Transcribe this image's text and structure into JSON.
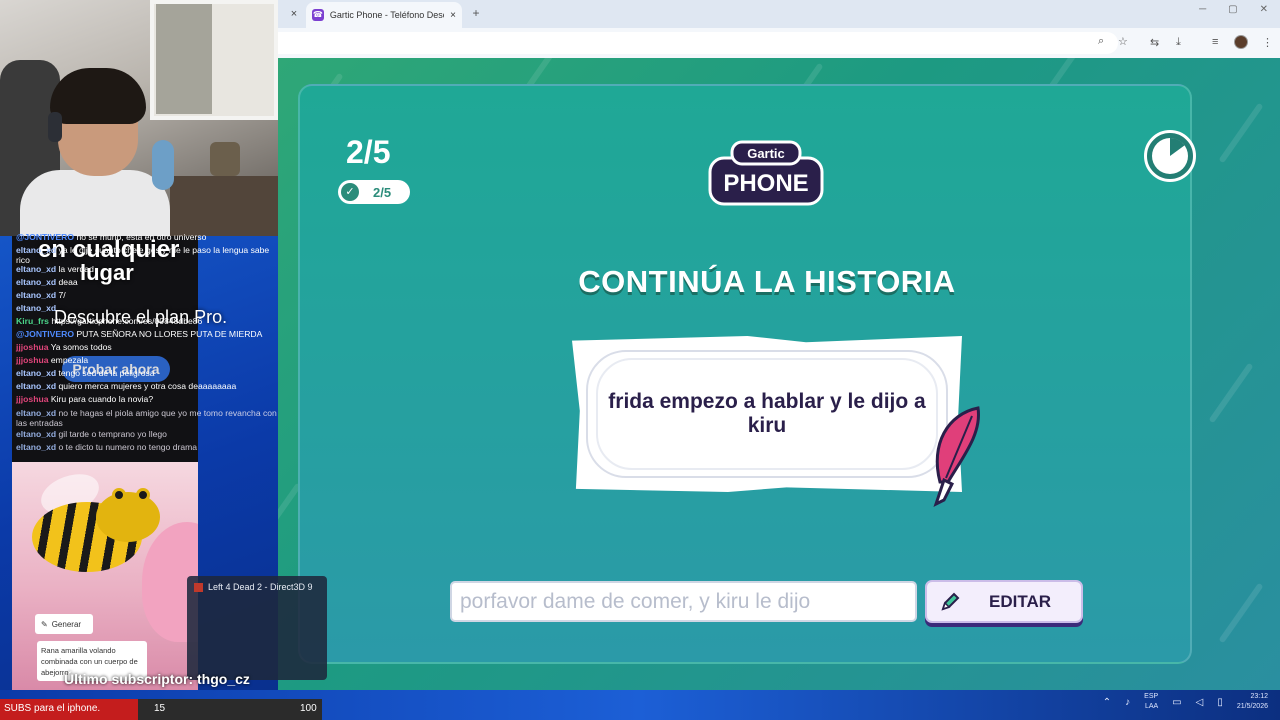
{
  "browser": {
    "tab_title": "Gartic Phone - Teléfono Descon",
    "new_tab": "+",
    "tab_close": "×",
    "prev_tab_close": "×"
  },
  "game": {
    "round_big": "2/5",
    "round_pill": "2/5",
    "logo_top": "Gartic",
    "logo_bottom": "PHONE",
    "heading": "CONTINÚA LA HISTORIA",
    "prompt": "frida empezo a hablar y le dijo a kiru",
    "answer_value": "porfavor dame de comer, y kiru le dijo",
    "edit_button": "EDITAR",
    "timer_progress": 0.85
  },
  "stream": {
    "chat": [
      {
        "user": "@JONTIVERO",
        "msg": "no se murio, esta en otro universo",
        "color": "#4f8bff"
      },
      {
        "user": "eltano_xd",
        "msg": "ya le dije cuanto chele ges y me le paso la lengua sabe rico",
        "color": "#a9c6ff"
      },
      {
        "user": "eltano_xd",
        "msg": "la verdad",
        "color": "#a9c6ff"
      },
      {
        "user": "eltano_xd",
        "msg": "deaa",
        "color": "#a9c6ff"
      },
      {
        "user": "eltano_xd",
        "msg": "7/",
        "color": "#a9c6ff"
      },
      {
        "user": "eltano_xd",
        "msg": "",
        "color": "#a9c6ff"
      },
      {
        "user": "Kiru_frs",
        "msg": "https://garticphone.com/es/00848dbe86",
        "color": "#4bd68a"
      },
      {
        "user": "@JONTIVERO",
        "msg": "PUTA SEÑORA NO LLORES PUTA DE MIERDA",
        "color": "#4f8bff"
      },
      {
        "user": "jjjoshua",
        "msg": "Ya somos todos",
        "color": "#e0457a"
      },
      {
        "user": "jjjoshua",
        "msg": "empezala",
        "color": "#e0457a"
      },
      {
        "user": "eltano_xd",
        "msg": "tengo sed de la peligrosa",
        "color": "#a9c6ff"
      },
      {
        "user": "eltano_xd",
        "msg": "quiero merca mujeres y otra cosa deaaaaaaaa",
        "color": "#a9c6ff"
      },
      {
        "user": "jjjoshua",
        "msg": "Kiru para cuando la novia?",
        "color": "#e0457a"
      },
      {
        "user": "eltano_xd",
        "msg": "no te hagas el piola amigo que yo me tomo revancha con las entradas",
        "color": "#a9c6ff"
      },
      {
        "user": "eltano_xd",
        "msg": "gil tarde o temprano yo llego",
        "color": "#a9c6ff"
      },
      {
        "user": "eltano_xd",
        "msg": "o te dicto tu numero no tengo drama",
        "color": "#a9c6ff"
      }
    ],
    "ad_line1": "en cualquier",
    "ad_line2": "lugar",
    "ad_line3": "Descubre el plan Pro.",
    "ad_button": "Probar ahora",
    "generate_button": "Generar",
    "generate_prompt": "Rana amarilla volando combinada con un cuerpo de abejorro",
    "last_sub": "Último subscriptor: thgo_cz",
    "game_window": "Left 4 Dead 2 - Direct3D 9",
    "subgoal": {
      "label": "SUBS para el iphone.",
      "current": "15",
      "goal": "100",
      "progress": 0.15
    }
  },
  "taskbar": {
    "lang_top": "ESP",
    "lang_bottom": "LAA",
    "time": "23:12",
    "date": "21/5/2026"
  },
  "colors": {
    "game_bg": "#1fa896",
    "heading_shadow": "#1b6e63",
    "button_shadow": "#3b2b7a",
    "feather": "#e03f7a"
  }
}
